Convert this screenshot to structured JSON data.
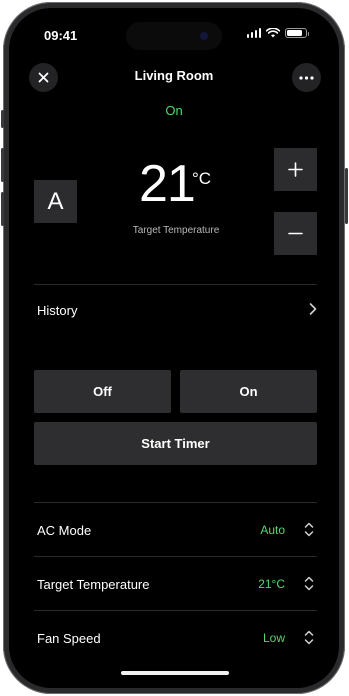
{
  "status_bar": {
    "time": "09:41",
    "battery_level": 0.85
  },
  "header": {
    "title": "Living Room",
    "close_icon": "close-icon",
    "more_icon": "more-icon"
  },
  "power": {
    "state": "On",
    "state_color": "#54d66b"
  },
  "climate": {
    "mode_letter": "A",
    "target_value": "21",
    "unit": "°C",
    "caption": "Target Temperature",
    "increase_icon": "plus-icon",
    "decrease_icon": "minus-icon"
  },
  "history": {
    "label": "History",
    "icon": "chevron-right-icon"
  },
  "actions": {
    "off_label": "Off",
    "on_label": "On",
    "timer_label": "Start Timer"
  },
  "settings": [
    {
      "label": "AC Mode",
      "value": "Auto",
      "icon": "updown-icon"
    },
    {
      "label": "Target Temperature",
      "value": "21°C",
      "icon": "updown-icon"
    },
    {
      "label": "Fan Speed",
      "value": "Low",
      "icon": "updown-icon"
    }
  ],
  "colors": {
    "accent": "#54d66b",
    "background": "#000000",
    "button": "#2e2e30"
  }
}
